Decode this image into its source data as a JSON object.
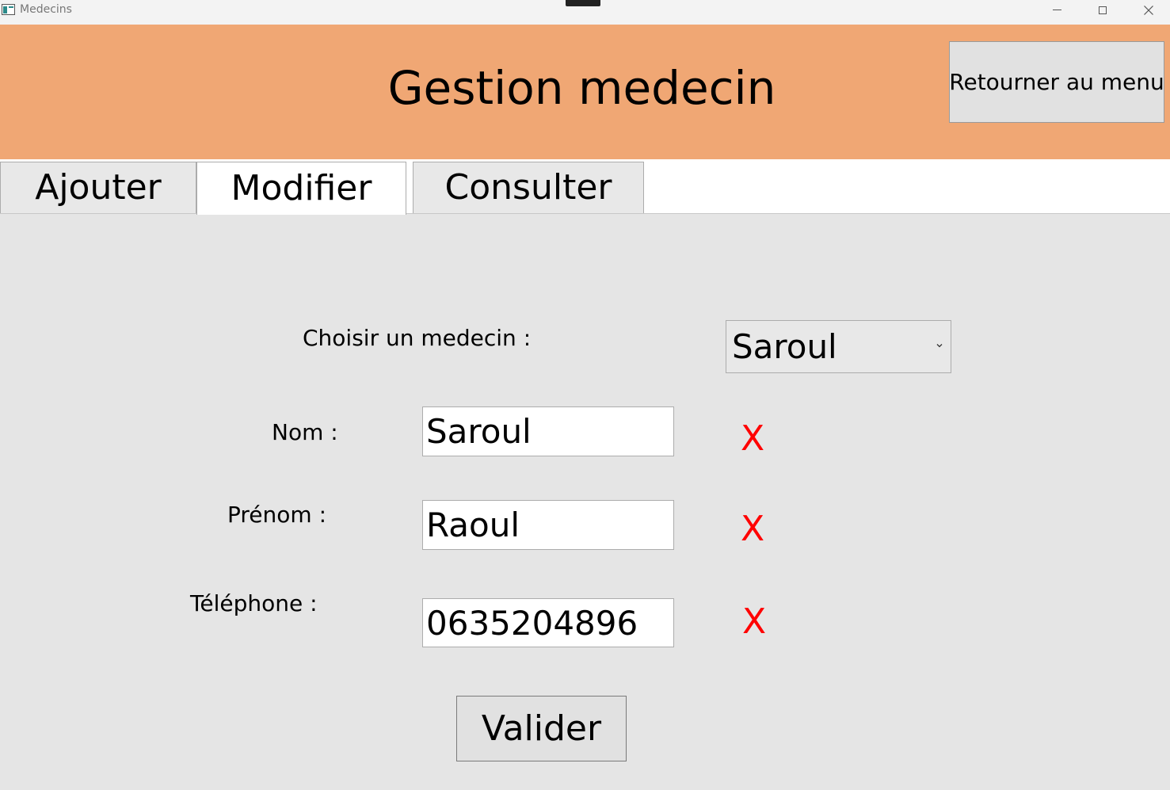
{
  "window": {
    "title": "Medecins",
    "controls": [
      "minimize-icon",
      "maximize-icon",
      "close-icon"
    ]
  },
  "header": {
    "title": "Gestion medecin",
    "back_button_label": "Retourner au menu",
    "background_color": "#f0a774"
  },
  "tabs": [
    {
      "label": "Ajouter",
      "selected": false
    },
    {
      "label": "Modifier",
      "selected": true
    },
    {
      "label": "Consulter",
      "selected": false
    }
  ],
  "form": {
    "choose_label": "Choisir un medecin :",
    "selected_medecin": "Saroul",
    "fields": {
      "nom": {
        "label": "Nom :",
        "value": "Saroul",
        "error_mark": "X"
      },
      "prenom": {
        "label": "Prénom :",
        "value": "Raoul",
        "error_mark": "X"
      },
      "telephone": {
        "label": "Téléphone :",
        "value": "0635204896",
        "error_mark": "X"
      }
    },
    "submit_label": "Valider",
    "error_color": "#ff0000"
  }
}
